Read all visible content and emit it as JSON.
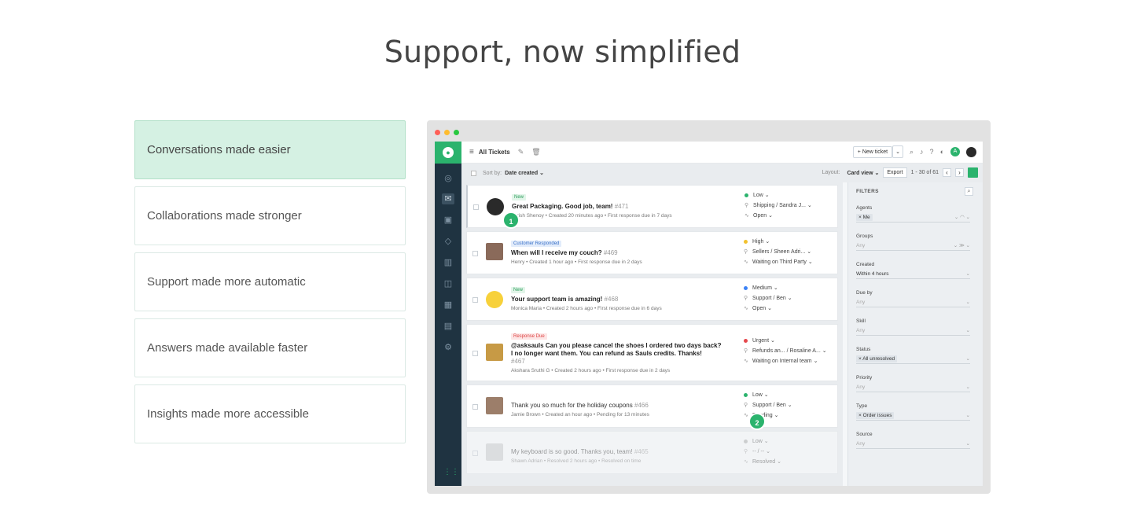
{
  "hero": {
    "title": "Support, now simplified"
  },
  "features": [
    {
      "label": "Conversations made easier",
      "active": true
    },
    {
      "label": "Collaborations made stronger",
      "active": false
    },
    {
      "label": "Support made more automatic",
      "active": false
    },
    {
      "label": "Answers made available faster",
      "active": false
    },
    {
      "label": "Insights made more accessible",
      "active": false
    }
  ],
  "window": {
    "dots": [
      "#ff5f57",
      "#febc2e",
      "#28c840"
    ],
    "colors": {
      "brand": "#2bb36d",
      "sidebar": "#1f3341"
    }
  },
  "topbar": {
    "title": "All Tickets",
    "new_ticket": "+ New ticket",
    "avatar_letter": "A"
  },
  "subbar": {
    "sort_label": "Sort by:",
    "sort_value": "Date created ⌄",
    "layout_label": "Layout:",
    "layout_value": "Card view ⌄",
    "export": "Export",
    "pagination": "1 - 30 of 61"
  },
  "tickets": [
    {
      "badge": "New",
      "badge_type": "new",
      "subject": "Great Packaging. Good job, team!",
      "num": "#471",
      "meta": "Girish Shenoy • Created 20 minutes ago • First response due in 7 days",
      "priority": "Low",
      "priority_color": "#2bb36d",
      "assignee": "Shipping / Sandra J...",
      "status": "Open"
    },
    {
      "badge": "Customer Responded",
      "badge_type": "cr",
      "subject": "When will I receive my couch?",
      "num": "#469",
      "meta": "Henry • Created 1 hour ago • First response due in 2 days",
      "priority": "High",
      "priority_color": "#f2c12e",
      "assignee": "Sellers / Sheen Adri...",
      "status": "Waiting on Third Party"
    },
    {
      "badge": "New",
      "badge_type": "new",
      "subject": "Your support team is amazing!",
      "num": "#468",
      "meta": "Monica Maria • Created 2 hours ago • First response due in 6 days",
      "priority": "Medium",
      "priority_color": "#3b82f6",
      "assignee": "Support / Ben",
      "status": "Open"
    },
    {
      "badge": "Response Due",
      "badge_type": "rd",
      "subject": "@asksauls Can you please cancel the shoes I ordered two days back? I no longer want them. You can refund as Sauls credits. Thanks!",
      "num": "#467",
      "meta": "Akshara Sruthi G • Created 2 hours ago • First response due in 2 days",
      "priority": "Urgent",
      "priority_color": "#e5484d",
      "assignee": "Refunds an... / Rosaline A...",
      "status": "Waiting on Internal team"
    },
    {
      "badge": "",
      "badge_type": "",
      "subject": "Thank you so much for the holiday coupons",
      "num": "#466",
      "meta": "Jamie Brown • Created an hour ago • Pending for 13 minutes",
      "priority": "Low",
      "priority_color": "#2bb36d",
      "assignee": "Support / Ben",
      "status": "Pending"
    },
    {
      "badge": "",
      "badge_type": "",
      "subject": "My keyboard is so good. Thanks you, team!",
      "num": "#465",
      "meta": "Shawn Adrian • Resolved 2 hours ago • Resolved on time",
      "priority": "Low",
      "priority_color": "#aaaaaa",
      "assignee": "-- / --",
      "status": "Resolved"
    }
  ],
  "markers": [
    "1",
    "2"
  ],
  "filters": {
    "title": "FILTERS",
    "groups": [
      {
        "label": "Agents",
        "value": "Me",
        "tag": true
      },
      {
        "label": "Groups",
        "value": "Any",
        "tag": false
      },
      {
        "label": "Created",
        "value": "Within 4 hours",
        "tag": false,
        "dark": true
      },
      {
        "label": "Due by",
        "value": "Any",
        "tag": false
      },
      {
        "label": "Skill",
        "value": "Any",
        "tag": false
      },
      {
        "label": "Status",
        "value": "All unresolved",
        "tag": true
      },
      {
        "label": "Priority",
        "value": "Any",
        "tag": false
      },
      {
        "label": "Type",
        "value": "Order issues",
        "tag": true
      },
      {
        "label": "Source",
        "value": "Any",
        "tag": false
      }
    ]
  }
}
